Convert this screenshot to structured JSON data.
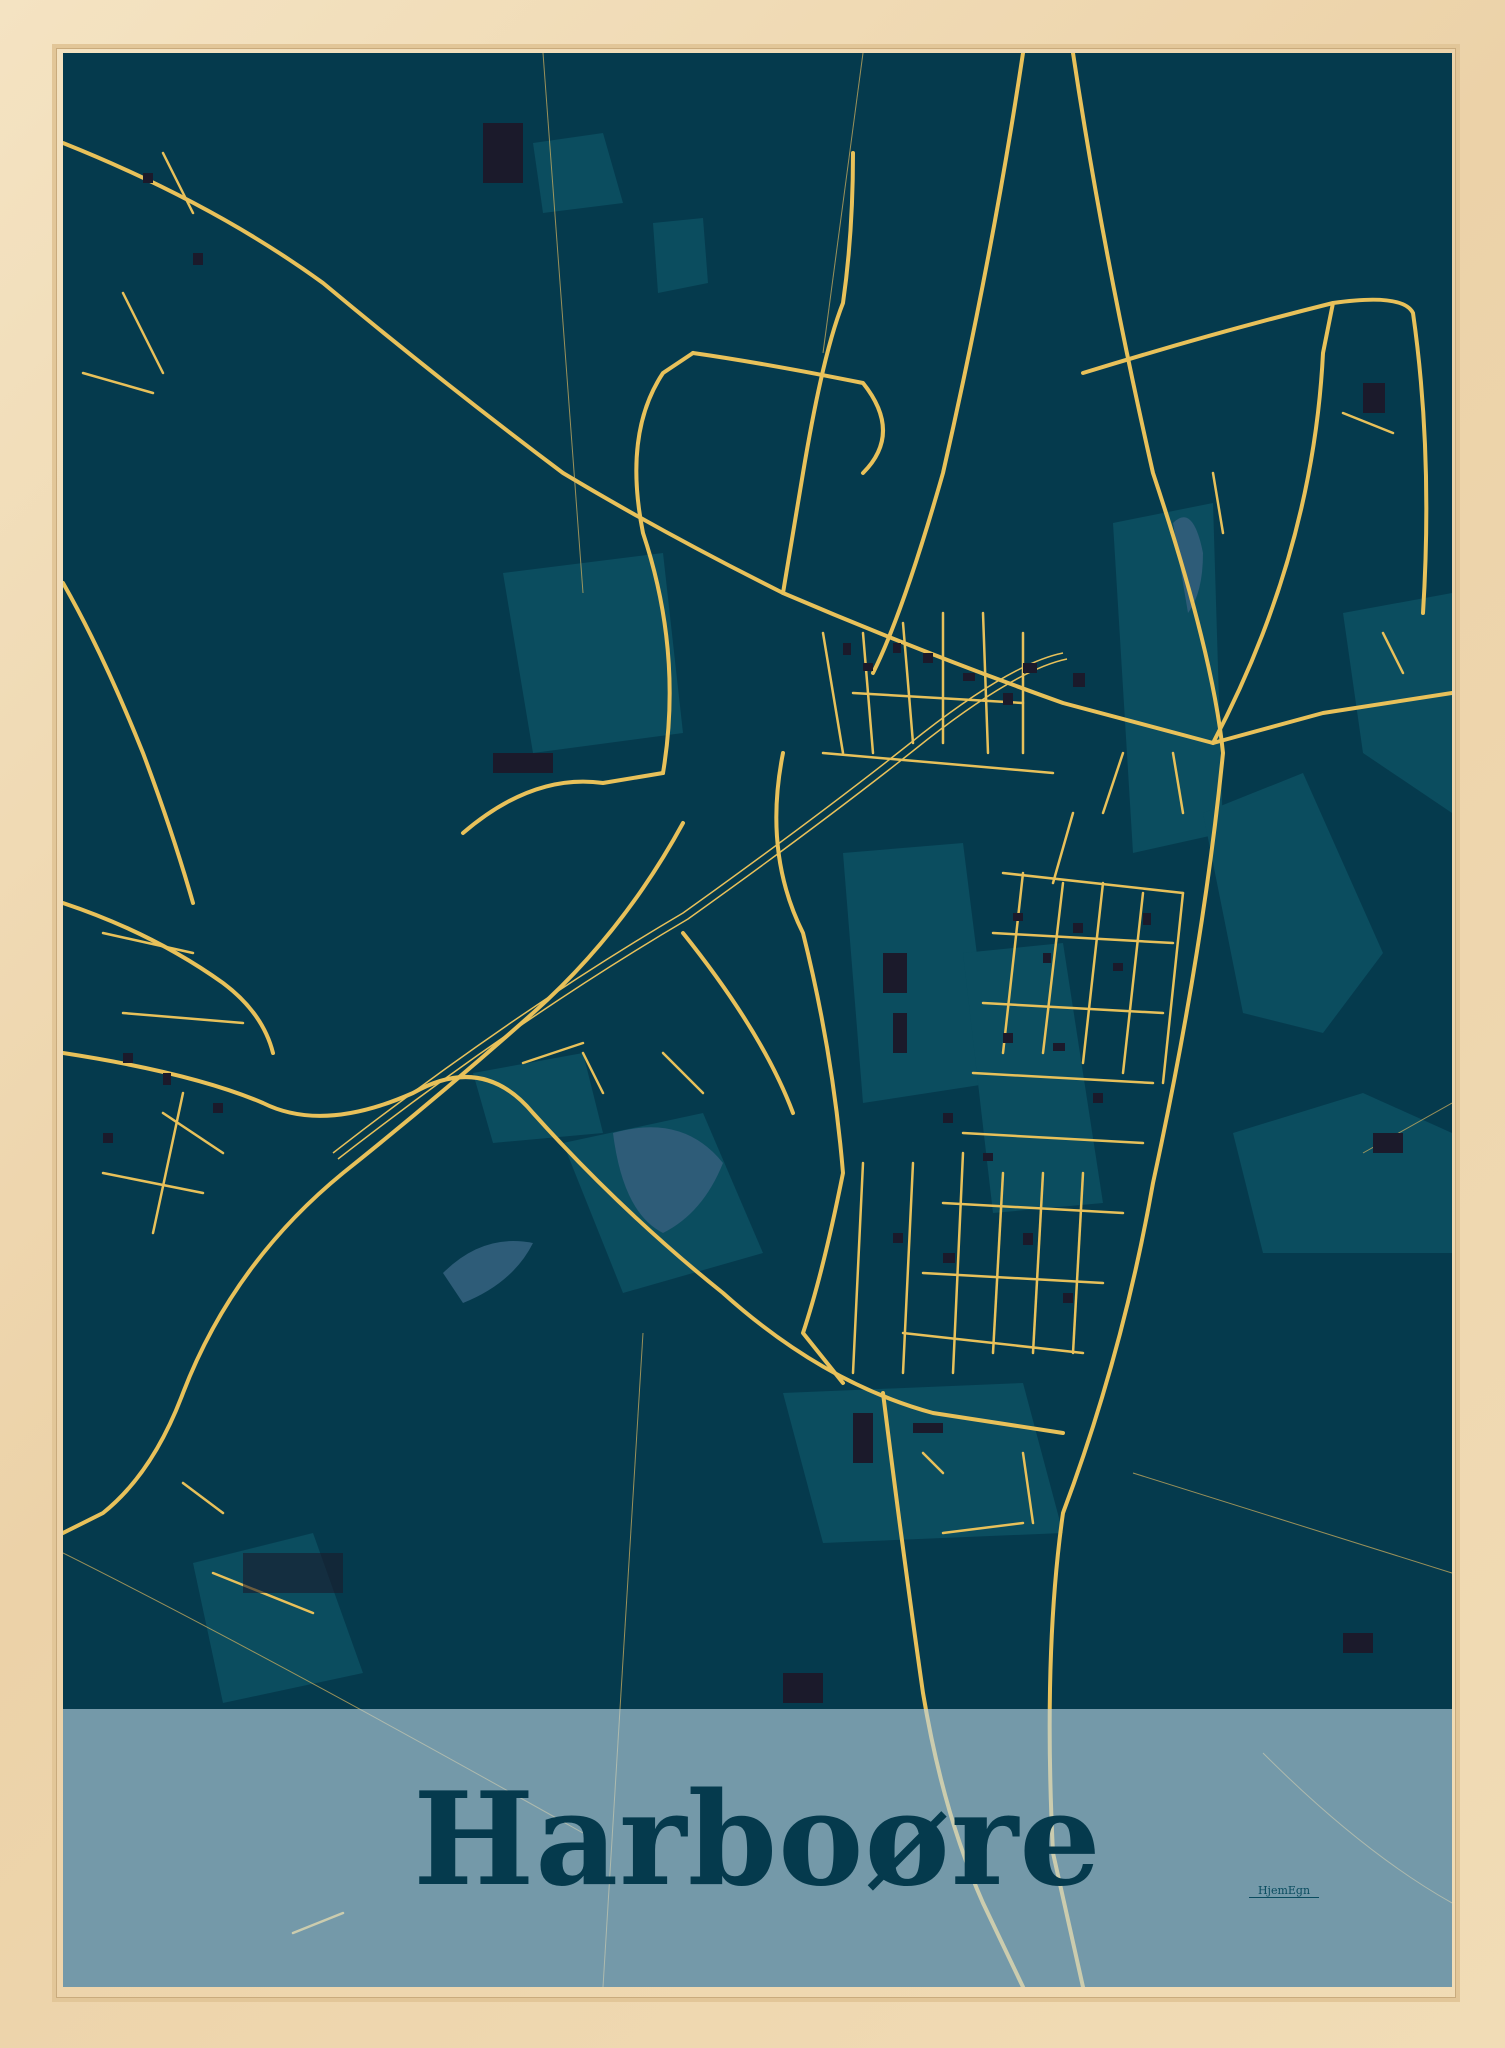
{
  "poster": {
    "title": "Harboøre",
    "brand": "HjemEgn"
  },
  "colors": {
    "frame": "#efd9b4",
    "background": "#053a4d",
    "areas": "#0b4d5f",
    "roads": "#e8c15a",
    "buildings": "#1b1a2b",
    "title": "#053a4d",
    "band": "#bad4e2"
  }
}
